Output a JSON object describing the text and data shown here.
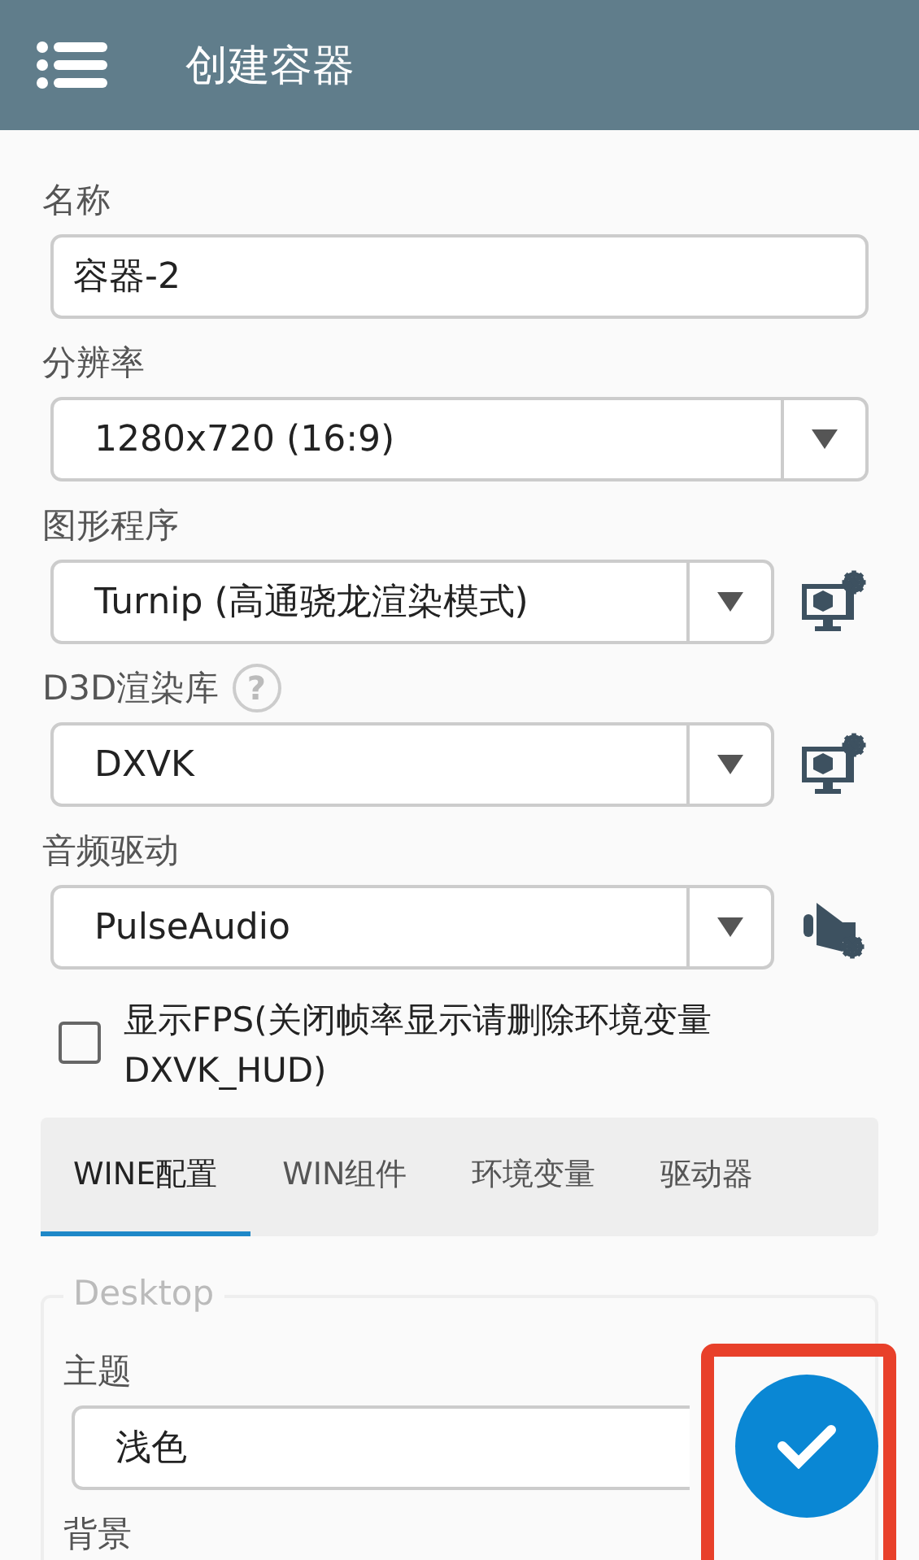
{
  "app_bar": {
    "title": "创建容器"
  },
  "fields": [
    {
      "label": "名称",
      "kind": "text",
      "value": "容器-2"
    },
    {
      "label": "分辨率",
      "kind": "select",
      "value": "1280x720 (16:9)"
    },
    {
      "label": "图形程序",
      "kind": "select",
      "value": "Turnip (高通骁龙渲染模式)",
      "settings": {
        "kind": "display"
      }
    },
    {
      "label": "D3D渲染库",
      "kind": "select",
      "value": "DXVK",
      "help": "?",
      "settings": {
        "kind": "display"
      }
    },
    {
      "label": "音频驱动",
      "kind": "select",
      "value": "PulseAudio",
      "settings": {
        "kind": "audio"
      }
    }
  ],
  "show_fps": {
    "label": "显示FPS(关闭帧率显示请删除环境变量DXVK_HUD)",
    "checked": false
  },
  "tabs": [
    {
      "label": "WINE配置",
      "selected": true
    },
    {
      "label": "WIN组件",
      "selected": false
    },
    {
      "label": "环境变量",
      "selected": false
    },
    {
      "label": "驱动器",
      "selected": false
    }
  ],
  "desktop": {
    "legend": "Desktop",
    "fields": [
      {
        "label": "主题",
        "kind": "select",
        "value": "浅色"
      },
      {
        "label": "背景",
        "kind": "label"
      }
    ]
  },
  "fab": {
    "kind": "confirm",
    "highlighted": true
  }
}
